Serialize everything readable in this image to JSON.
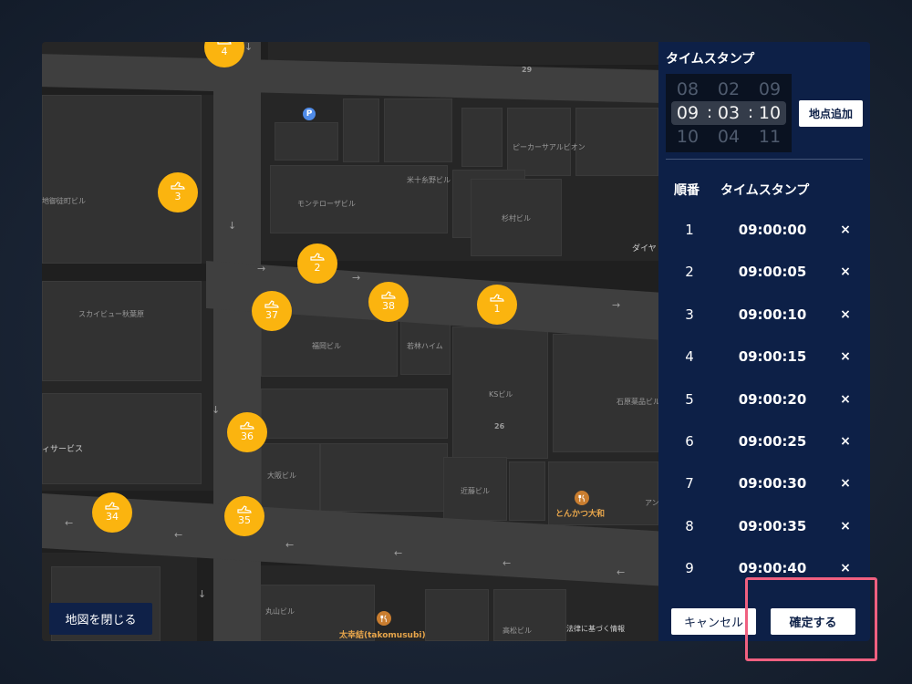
{
  "map": {
    "close_button": "地図を閉じる",
    "labels": {
      "block_29": "29",
      "block_26": "26",
      "pcar_pavilion": "ピーカーサアルビオン",
      "yonejuppanno_bldg": "米十糸野ビル",
      "montero_bldg": "モンテローザビル",
      "sugimura_bldg": "杉村ビル",
      "chiotekicho_bldg": "地御徒町ビル",
      "dia": "ダイヤ",
      "skyview": "スカイビュー秋葉原",
      "fukuoka_bldg": "福岡ビル",
      "wakabayashi_heim": "若林ハイム",
      "ks_bldg": "KSビル",
      "ishihara_bldg": "石原薬品ビル",
      "service": "ィサービス",
      "osaka_bldg": "大阪ビル",
      "kondo_bldg": "近藤ビル",
      "tonkatsu": "とんかつ大和",
      "an": "アン",
      "maruyama_bldg": "丸山ビル",
      "takomusubi": "太幸結(takomusubi)",
      "takamatsu_bldg": "高松ビル",
      "legal": "法律に基づく情報",
      "parking": "P"
    },
    "markers": [
      {
        "number": "4"
      },
      {
        "number": "3"
      },
      {
        "number": "2"
      },
      {
        "number": "37"
      },
      {
        "number": "38"
      },
      {
        "number": "1"
      },
      {
        "number": "36"
      },
      {
        "number": "34"
      },
      {
        "number": "35"
      }
    ],
    "accent_color": "#fbb40f"
  },
  "panel": {
    "title": "タイムスタンプ",
    "picker": {
      "hours": [
        "08",
        "09",
        "10"
      ],
      "minutes": [
        "02",
        "03",
        "04"
      ],
      "seconds": [
        "09",
        "10",
        "11"
      ],
      "separator": ":"
    },
    "add_button": "地点追加",
    "table": {
      "headers": [
        "順番",
        "タイムスタンプ"
      ],
      "rows": [
        {
          "num": "1",
          "time": "09:00:00",
          "del": "×"
        },
        {
          "num": "2",
          "time": "09:00:05",
          "del": "×"
        },
        {
          "num": "3",
          "time": "09:00:10",
          "del": "×"
        },
        {
          "num": "4",
          "time": "09:00:15",
          "del": "×"
        },
        {
          "num": "5",
          "time": "09:00:20",
          "del": "×"
        },
        {
          "num": "6",
          "time": "09:00:25",
          "del": "×"
        },
        {
          "num": "7",
          "time": "09:00:30",
          "del": "×"
        },
        {
          "num": "8",
          "time": "09:00:35",
          "del": "×"
        },
        {
          "num": "9",
          "time": "09:00:40",
          "del": "×"
        }
      ]
    },
    "cancel_button": "キャンセル",
    "confirm_button": "確定する",
    "background_color": "#0d2047"
  }
}
